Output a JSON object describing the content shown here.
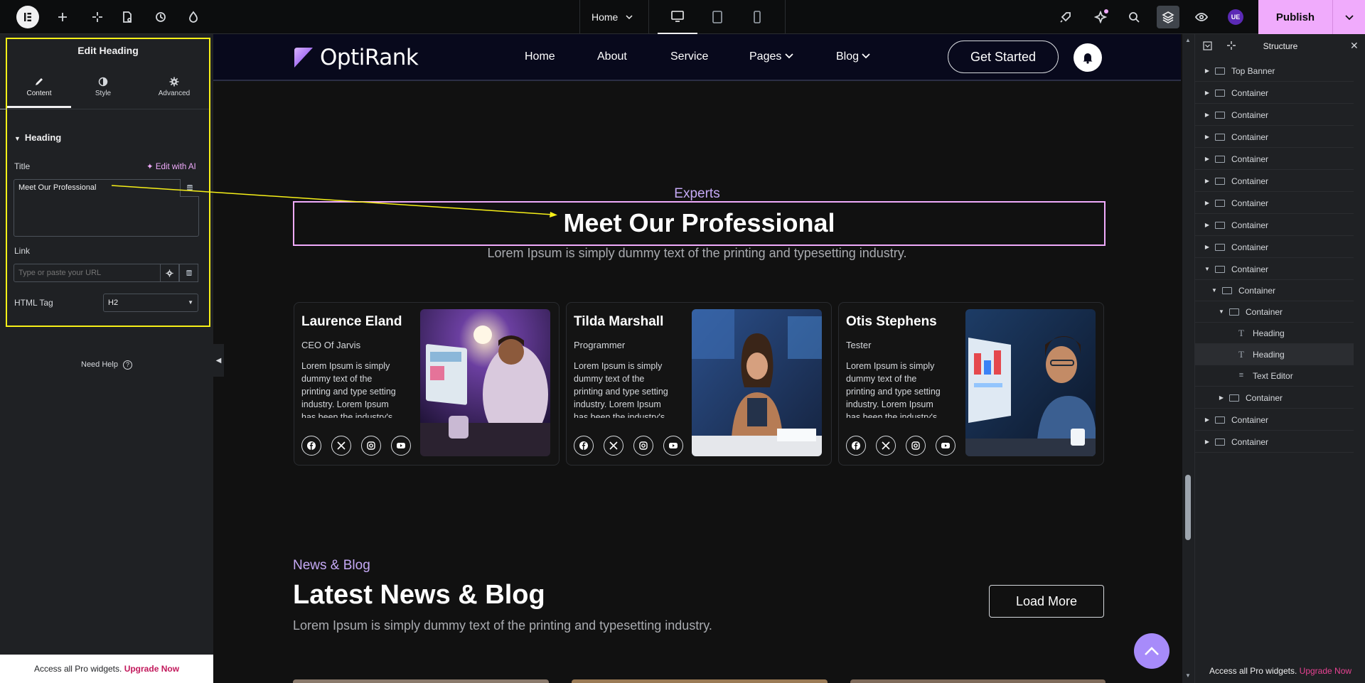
{
  "topbar": {
    "page_name": "Home",
    "publish_label": "Publish",
    "avatar_initials": "UE"
  },
  "left_panel": {
    "title": "Edit Heading",
    "tabs": [
      {
        "label": "Content"
      },
      {
        "label": "Style"
      },
      {
        "label": "Advanced"
      }
    ],
    "section_title": "Heading",
    "title_label": "Title",
    "edit_ai_label": "Edit with AI",
    "title_value": "Meet Our Professional",
    "link_label": "Link",
    "link_placeholder": "Type or paste your URL",
    "html_tag_label": "HTML Tag",
    "html_tag_value": "H2",
    "need_help": "Need Help",
    "upgrade_text": "Access all Pro widgets.",
    "upgrade_link": "Upgrade Now"
  },
  "site": {
    "brand": "OptiRank",
    "nav": [
      "Home",
      "About",
      "Service",
      "Pages",
      "Blog"
    ],
    "cta": "Get Started",
    "team_tag": "Experts",
    "team_title": "Meet Our Professional",
    "team_subtitle": "Lorem Ipsum is simply dummy text of the printing and typesetting industry.",
    "members": [
      {
        "name": "Laurence Eland",
        "role": "CEO Of Jarvis",
        "desc": "Lorem Ipsum is simply dummy text of the printing and type setting industry. Lorem Ipsum has been the industry's"
      },
      {
        "name": "Tilda Marshall",
        "role": "Programmer",
        "desc": "Lorem Ipsum is simply dummy text of the printing and type setting industry. Lorem Ipsum has been the industry's"
      },
      {
        "name": "Otis Stephens",
        "role": "Tester",
        "desc": "Lorem Ipsum is simply dummy text of the printing and type setting industry. Lorem Ipsum has been the industry's"
      }
    ],
    "news_tag": "News & Blog",
    "news_title": "Latest News & Blog",
    "news_subtitle": "Lorem Ipsum is simply dummy text of the printing and typesetting industry.",
    "load_more": "Load More"
  },
  "structure": {
    "title": "Structure",
    "items": [
      {
        "label": "Top Banner"
      },
      {
        "label": "Container"
      },
      {
        "label": "Container"
      },
      {
        "label": "Container"
      },
      {
        "label": "Container"
      },
      {
        "label": "Container"
      },
      {
        "label": "Container"
      },
      {
        "label": "Container"
      },
      {
        "label": "Container"
      },
      {
        "label": "Container"
      },
      {
        "label": "Container"
      },
      {
        "label": "Container"
      },
      {
        "label": "Heading"
      },
      {
        "label": "Heading"
      },
      {
        "label": "Text Editor"
      },
      {
        "label": "Container"
      },
      {
        "label": "Container"
      },
      {
        "label": "Container"
      }
    ],
    "upgrade_text": "Access all Pro widgets.",
    "upgrade_link": "Upgrade Now"
  },
  "colors": {
    "accent": "#f0abfc",
    "highlight": "#f7f018",
    "brand_purple": "#a78bfa"
  }
}
